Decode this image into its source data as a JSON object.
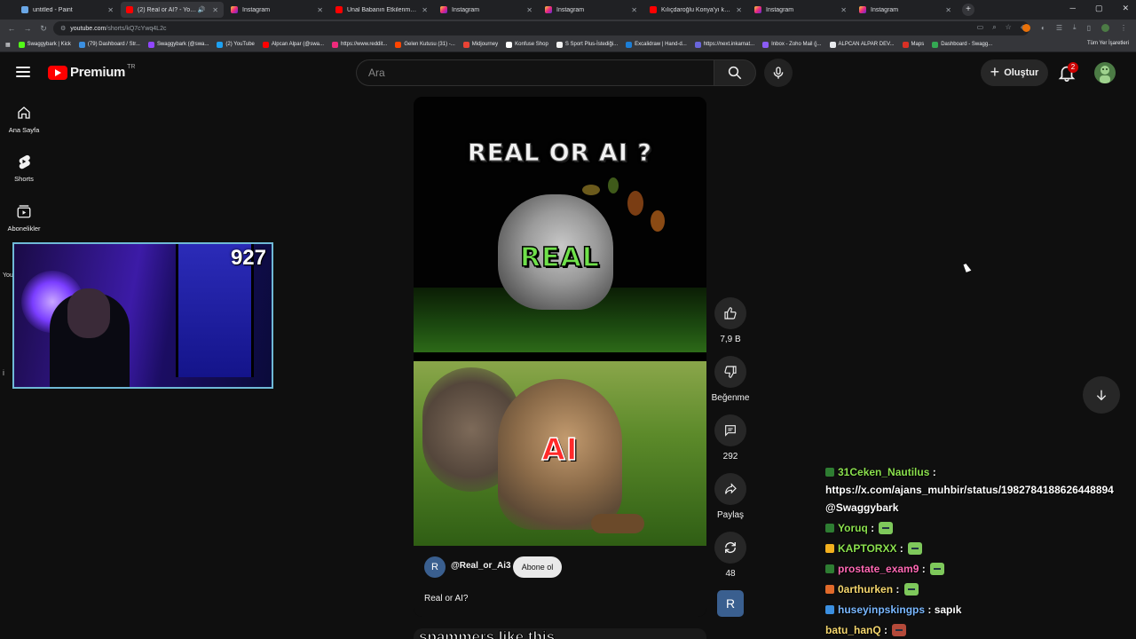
{
  "browser": {
    "tabs": [
      {
        "title": "untitled - Paint",
        "icon": "paint",
        "active": false
      },
      {
        "title": "(2) Real or AI? - YouTube",
        "icon": "youtube",
        "active": true,
        "audio": true
      },
      {
        "title": "Instagram",
        "icon": "instagram",
        "active": false
      },
      {
        "title": "Ünal Babanın Etkilenmek Sevgisi",
        "icon": "youtube",
        "active": false
      },
      {
        "title": "Instagram",
        "icon": "instagram",
        "active": false
      },
      {
        "title": "Instagram",
        "icon": "instagram",
        "active": false
      },
      {
        "title": "Kılıçdaroğlu Konya'yı kazanmış",
        "icon": "youtube",
        "active": false
      },
      {
        "title": "Instagram",
        "icon": "instagram",
        "active": false
      },
      {
        "title": "Instagram",
        "icon": "instagram",
        "active": false
      }
    ],
    "url_host": "youtube.com",
    "url_path": "/shorts/kQ7cYwq4L2c",
    "bookmarks": [
      "Swaggybark | Kick",
      "(79) Dashboard / Str...",
      "Swaggybark (@swa...",
      "(2) YouTube",
      "Alpcan Alpar (@swa...",
      "https://www.reddit...",
      "Gelen Kutusu (31) -...",
      "Midjourney",
      "Konfuse Shop",
      "S Sport Plus-İstediği...",
      "Excalidraw | Hand-d...",
      "https://next.inkarnat...",
      "Inbox - Zoho Mail (j...",
      "ALPCAN ALPAR DEV...",
      "Maps",
      "Dashboard - Swagg..."
    ],
    "bookmarks_right": "Tüm Yer İşaretleri"
  },
  "youtube": {
    "logo_text": "Premium",
    "country": "TR",
    "search_placeholder": "Ara",
    "create_label": "Oluştur",
    "notification_count": "2",
    "guide": [
      {
        "label": "Ana Sayfa",
        "icon": "home-icon"
      },
      {
        "label": "Shorts",
        "icon": "shorts-icon"
      },
      {
        "label": "Abonelikler",
        "icon": "subscriptions-icon"
      }
    ],
    "guide_cut_labels": [
      "You",
      "İ"
    ]
  },
  "webcam": {
    "viewer_count": "927"
  },
  "short": {
    "overlay_title": "REAL OR AI ?",
    "overlay_real": "REAL",
    "overlay_ai": "AI",
    "channel_initial": "R",
    "channel_handle": "@Real_or_Ai3",
    "subscribe_label": "Abone ol",
    "title": "Real or AI?",
    "next_preview_text": "spammers like this"
  },
  "actions": {
    "like_count": "7,9 B",
    "dislike_label": "Beğenme",
    "comment_count": "292",
    "share_label": "Paylaş",
    "remix_count": "48",
    "channel_initial": "R"
  },
  "chat": [
    {
      "user": "31Ceken_Nautilus",
      "user_color": "#8be04e",
      "badge": "#2e7d32",
      "message": "https://x.com/ajans_muhbir/status/1982784188626448894",
      "message2": "@Swaggybark",
      "emote": false
    },
    {
      "user": "Yoruq",
      "user_color": "#8be04e",
      "badge": "#2e7d32",
      "message": "",
      "emote": true
    },
    {
      "user": "KAPTORXX",
      "user_color": "#8be04e",
      "badge": "#f2b01e",
      "message": "",
      "emote": true
    },
    {
      "user": "prostate_exam9",
      "user_color": "#ff69b4",
      "badge": "#2e7d32",
      "message": "",
      "emote": true
    },
    {
      "user": "0arthurken",
      "user_color": "#f5d76e",
      "badge": "#e06a2a",
      "message": "",
      "emote": true
    },
    {
      "user": "huseyinpskingps",
      "user_color": "#7ab8ff",
      "badge": "#3b8fe0",
      "message": "sapık",
      "emote": false
    },
    {
      "user": "batu_hanQ",
      "user_color": "#f5d76e",
      "badge": "",
      "message": "",
      "emote": true,
      "emote_red": true
    }
  ],
  "colors": {
    "youtube_red": "#ff0000",
    "background": "#0f0f0f",
    "real_green": "#6fe04a",
    "ai_red": "#ff2a2a",
    "webcam_border": "#6fb9d6"
  }
}
